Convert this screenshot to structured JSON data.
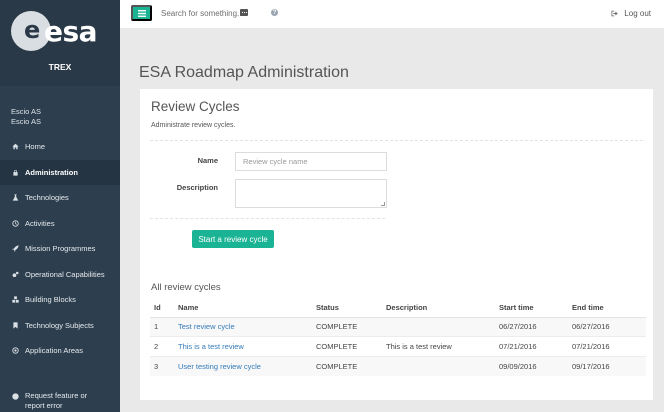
{
  "sidebar": {
    "logo_text": "esa",
    "app_name": "TREX",
    "user": {
      "line1": "Escio AS",
      "line2": "Escio AS"
    },
    "items": [
      {
        "label": "Home",
        "icon": "home-icon",
        "active": false
      },
      {
        "label": "Administration",
        "icon": "lock-icon",
        "active": true
      },
      {
        "label": "Technologies",
        "icon": "flask-icon",
        "active": false
      },
      {
        "label": "Activities",
        "icon": "clock-icon",
        "active": false
      },
      {
        "label": "Mission Programmes",
        "icon": "rocket-icon",
        "active": false
      },
      {
        "label": "Operational Capabilities",
        "icon": "gears-icon",
        "active": false
      },
      {
        "label": "Building Blocks",
        "icon": "cubes-icon",
        "active": false
      },
      {
        "label": "Technology Subjects",
        "icon": "bookmark-icon",
        "active": false
      },
      {
        "label": "Application Areas",
        "icon": "target-icon",
        "active": false
      }
    ],
    "feature_request": "Request feature or report error"
  },
  "topbar": {
    "search_placeholder": "Search for something...",
    "logout_label": "Log out"
  },
  "page": {
    "title": "ESA Roadmap Administration"
  },
  "panel": {
    "title": "Review Cycles",
    "subtitle": "Administrate review cycles.",
    "form": {
      "name_label": "Name",
      "name_placeholder": "Review cycle name",
      "description_label": "Description",
      "description_value": "",
      "submit_label": "Start a review cycle"
    },
    "list_title": "All review cycles",
    "table": {
      "headers": [
        "Id",
        "Name",
        "Status",
        "Description",
        "Start time",
        "End time"
      ],
      "rows": [
        {
          "id": "1",
          "name": "Test review cycle",
          "status": "COMPLETE",
          "description": "",
          "start": "06/27/2016",
          "end": "06/27/2016"
        },
        {
          "id": "2",
          "name": "This is a test review",
          "status": "COMPLETE",
          "description": "This is a test review",
          "start": "07/21/2016",
          "end": "07/21/2016"
        },
        {
          "id": "3",
          "name": "User testing review cycle",
          "status": "COMPLETE",
          "description": "",
          "start": "09/09/2016",
          "end": "09/17/2016"
        }
      ]
    }
  },
  "colors": {
    "accent": "#1ab394",
    "sidebar": "#2d3e4e",
    "link": "#337ab7"
  }
}
